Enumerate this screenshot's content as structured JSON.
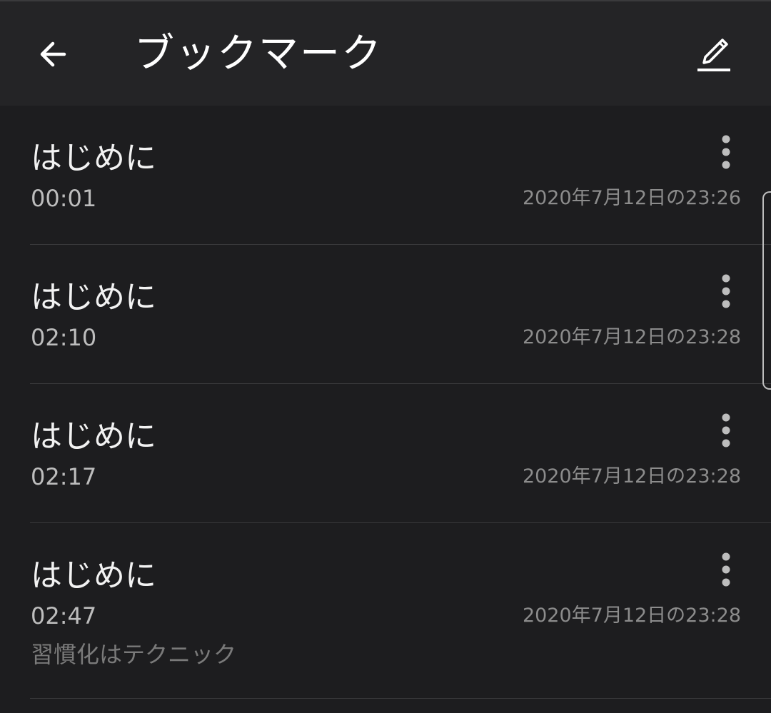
{
  "header": {
    "title": "ブックマーク",
    "back_icon": "arrow-left-icon",
    "edit_icon": "pencil-icon"
  },
  "bookmarks": [
    {
      "title": "はじめに",
      "time": "00:01",
      "date": "2020年7月12日の23:26",
      "note": ""
    },
    {
      "title": "はじめに",
      "time": "02:10",
      "date": "2020年7月12日の23:28",
      "note": ""
    },
    {
      "title": "はじめに",
      "time": "02:17",
      "date": "2020年7月12日の23:28",
      "note": ""
    },
    {
      "title": "はじめに",
      "time": "02:47",
      "date": "2020年7月12日の23:28",
      "note": "習慣化はテクニック"
    }
  ],
  "colors": {
    "background": "#1d1d1f",
    "appbar": "#242426",
    "primary_text": "#f2f2f2",
    "secondary_text": "#bdbdbd",
    "date_text": "#8c8c8c",
    "divider": "#3a3a3c"
  }
}
